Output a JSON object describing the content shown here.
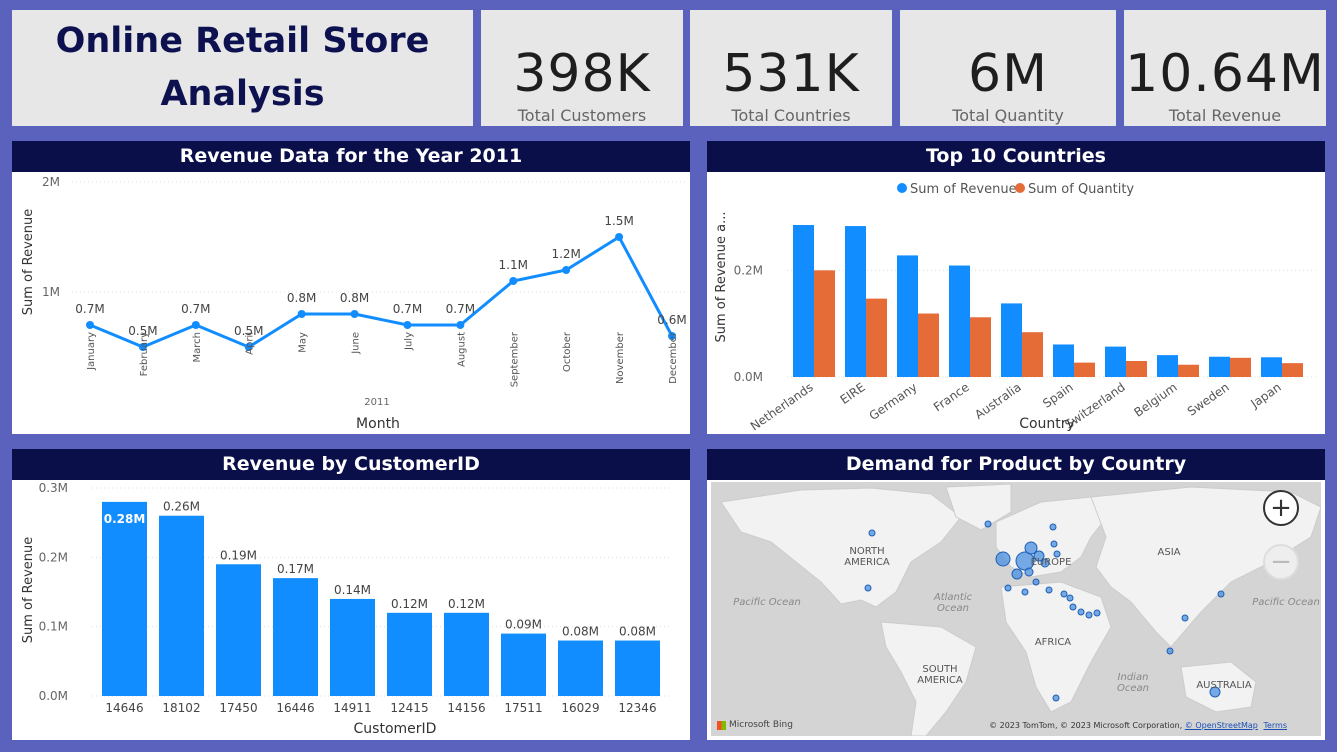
{
  "title": "Online Retail Store Analysis",
  "kpis": [
    {
      "value": "398K",
      "label": "Total Customers"
    },
    {
      "value": "531K",
      "label": "Total Countries"
    },
    {
      "value": "6M",
      "label": "Total Quantity"
    },
    {
      "value": "10.64M",
      "label": "Total Revenue"
    }
  ],
  "panels": {
    "revenue_2011": "Revenue Data for the Year 2011",
    "top_countries": "Top 10 Countries",
    "by_customer": "Revenue by CustomerID",
    "map": "Demand for Product by Country"
  },
  "colors": {
    "blue": "#118DFF",
    "orange": "#E66C37",
    "navy": "#0A0F4A",
    "background": "#5B62BE"
  },
  "chart_data": [
    {
      "type": "line",
      "title": "Revenue Data for the Year 2011",
      "xlabel": "Month",
      "xsublabel": "2011",
      "ylabel": "Sum of Revenue",
      "ylim": [
        0,
        2
      ],
      "yticks": [
        "1M",
        "2M"
      ],
      "categories": [
        "January",
        "February",
        "March",
        "April",
        "May",
        "June",
        "July",
        "August",
        "September",
        "October",
        "November",
        "December"
      ],
      "values": [
        0.7,
        0.5,
        0.7,
        0.5,
        0.8,
        0.8,
        0.7,
        0.7,
        1.1,
        1.2,
        1.5,
        0.6
      ],
      "labels": [
        "0.7M",
        "0.5M",
        "0.7M",
        "0.5M",
        "0.8M",
        "0.8M",
        "0.7M",
        "0.7M",
        "1.1M",
        "1.2M",
        "1.5M",
        "0.6M"
      ],
      "color": "#118DFF"
    },
    {
      "type": "bar",
      "title": "Top 10 Countries",
      "xlabel": "Country",
      "ylabel": "Sum of Revenue a...",
      "ylim": [
        0,
        0.3
      ],
      "yticks": [
        "0.0M",
        "0.2M"
      ],
      "categories": [
        "Netherlands",
        "EIRE",
        "Germany",
        "France",
        "Australia",
        "Spain",
        "Switzerland",
        "Belgium",
        "Sweden",
        "Japan"
      ],
      "series": [
        {
          "name": "Sum of Revenue",
          "color": "#118DFF",
          "values": [
            0.285,
            0.283,
            0.228,
            0.209,
            0.138,
            0.061,
            0.057,
            0.041,
            0.038,
            0.037
          ]
        },
        {
          "name": "Sum of Quantity",
          "color": "#E66C37",
          "values": [
            0.2,
            0.147,
            0.119,
            0.112,
            0.084,
            0.027,
            0.03,
            0.023,
            0.036,
            0.026
          ]
        }
      ],
      "legend": "top-center"
    },
    {
      "type": "bar",
      "title": "Revenue by CustomerID",
      "xlabel": "CustomerID",
      "ylabel": "Sum of Revenue",
      "ylim": [
        0,
        0.3
      ],
      "yticks": [
        "0.0M",
        "0.1M",
        "0.2M",
        "0.3M"
      ],
      "categories": [
        "14646",
        "18102",
        "17450",
        "16446",
        "14911",
        "12415",
        "14156",
        "17511",
        "16029",
        "12346"
      ],
      "values": [
        0.28,
        0.26,
        0.19,
        0.17,
        0.14,
        0.12,
        0.12,
        0.09,
        0.08,
        0.08
      ],
      "labels": [
        "0.28M",
        "0.26M",
        "0.19M",
        "0.17M",
        "0.14M",
        "0.12M",
        "0.12M",
        "0.09M",
        "0.08M",
        "0.08M"
      ],
      "color": "#118DFF"
    }
  ],
  "map": {
    "labels": {
      "north_america": [
        "NORTH",
        "AMERICA"
      ],
      "south_america": [
        "SOUTH",
        "AMERICA"
      ],
      "europe": "EUROPE",
      "asia": "ASIA",
      "africa": "AFRICA",
      "atlantic": [
        "Atlantic",
        "Ocean"
      ],
      "pacific_left": "Pacific Ocean",
      "pacific_right": "Pacific Ocean",
      "indian": [
        "Indian",
        "Ocean"
      ],
      "australia": "AUSTRALIA"
    },
    "zoom_in_icon": "plus-icon",
    "zoom_out_icon": "minus-icon",
    "attribution": "© 2023 TomTom, © 2023 Microsoft Corporation,",
    "osm_link": "© OpenStreetMap",
    "terms_link": "Terms",
    "bing_logo": "Microsoft Bing"
  }
}
